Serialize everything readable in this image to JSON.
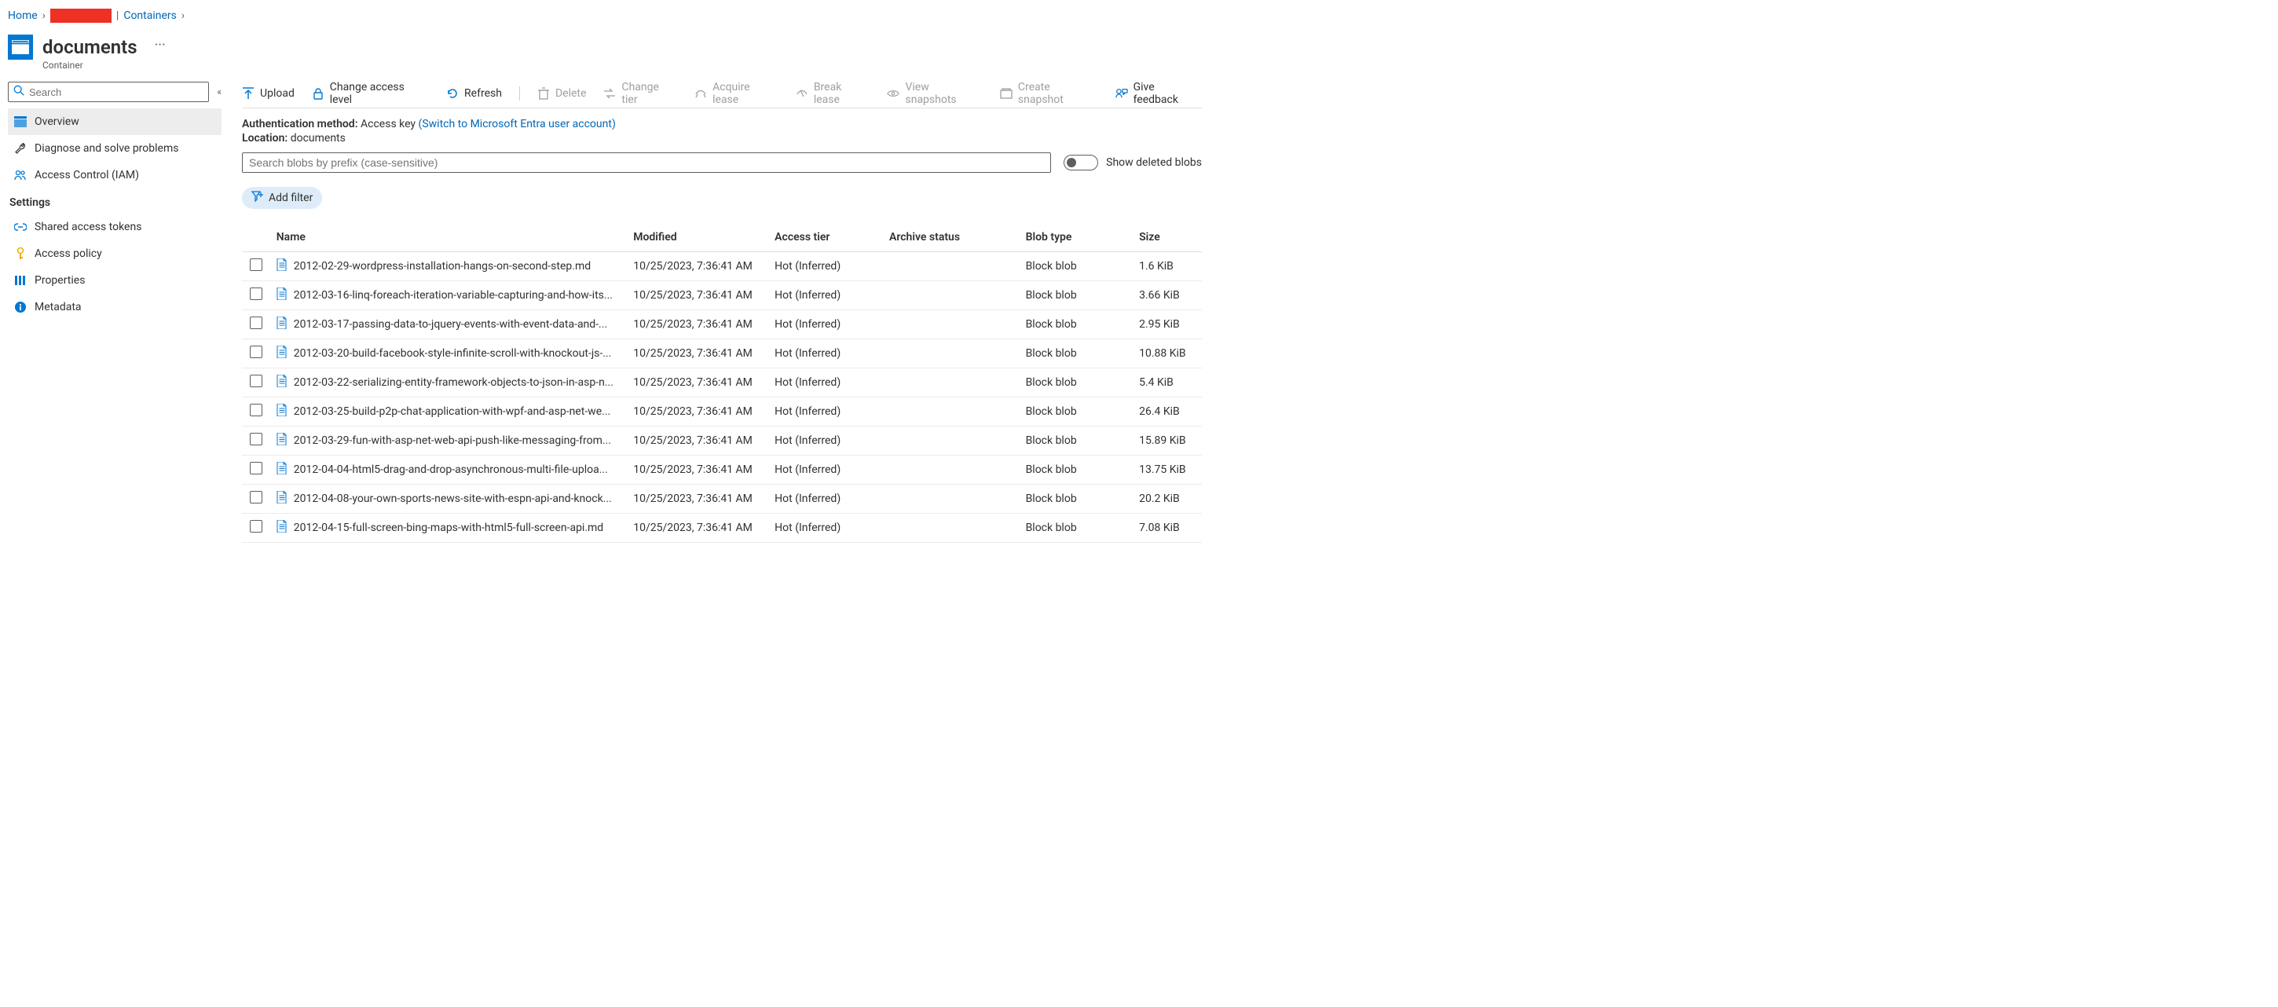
{
  "breadcrumb": {
    "home": "Home",
    "containers": "Containers"
  },
  "title": "documents",
  "subtitle": "Container",
  "sidebar": {
    "search_placeholder": "Search",
    "items": {
      "overview": "Overview",
      "diagnose": "Diagnose and solve problems",
      "iam": "Access Control (IAM)"
    },
    "settings_header": "Settings",
    "settings": {
      "sas": "Shared access tokens",
      "access_policy": "Access policy",
      "properties": "Properties",
      "metadata": "Metadata"
    }
  },
  "toolbar": {
    "upload": "Upload",
    "change_access": "Change access level",
    "refresh": "Refresh",
    "delete": "Delete",
    "change_tier": "Change tier",
    "acquire_lease": "Acquire lease",
    "break_lease": "Break lease",
    "view_snapshots": "View snapshots",
    "create_snapshot": "Create snapshot",
    "feedback": "Give feedback"
  },
  "meta": {
    "auth_label": "Authentication method:",
    "auth_value": "Access key",
    "switch_link": "(Switch to Microsoft Entra user account)",
    "location_label": "Location:",
    "location_value": "documents"
  },
  "search_blobs_placeholder": "Search blobs by prefix (case-sensitive)",
  "show_deleted_label": "Show deleted blobs",
  "add_filter_label": "Add filter",
  "columns": {
    "name": "Name",
    "modified": "Modified",
    "tier": "Access tier",
    "archive": "Archive status",
    "type": "Blob type",
    "size": "Size"
  },
  "rows": [
    {
      "name": "2012-02-29-wordpress-installation-hangs-on-second-step.md",
      "modified": "10/25/2023, 7:36:41 AM",
      "tier": "Hot (Inferred)",
      "archive": "",
      "type": "Block blob",
      "size": "1.6 KiB"
    },
    {
      "name": "2012-03-16-linq-foreach-iteration-variable-capturing-and-how-its...",
      "modified": "10/25/2023, 7:36:41 AM",
      "tier": "Hot (Inferred)",
      "archive": "",
      "type": "Block blob",
      "size": "3.66 KiB"
    },
    {
      "name": "2012-03-17-passing-data-to-jquery-events-with-event-data-and-...",
      "modified": "10/25/2023, 7:36:41 AM",
      "tier": "Hot (Inferred)",
      "archive": "",
      "type": "Block blob",
      "size": "2.95 KiB"
    },
    {
      "name": "2012-03-20-build-facebook-style-infinite-scroll-with-knockout-js-...",
      "modified": "10/25/2023, 7:36:41 AM",
      "tier": "Hot (Inferred)",
      "archive": "",
      "type": "Block blob",
      "size": "10.88 KiB"
    },
    {
      "name": "2012-03-22-serializing-entity-framework-objects-to-json-in-asp-n...",
      "modified": "10/25/2023, 7:36:41 AM",
      "tier": "Hot (Inferred)",
      "archive": "",
      "type": "Block blob",
      "size": "5.4 KiB"
    },
    {
      "name": "2012-03-25-build-p2p-chat-application-with-wpf-and-asp-net-we...",
      "modified": "10/25/2023, 7:36:41 AM",
      "tier": "Hot (Inferred)",
      "archive": "",
      "type": "Block blob",
      "size": "26.4 KiB"
    },
    {
      "name": "2012-03-29-fun-with-asp-net-web-api-push-like-messaging-from...",
      "modified": "10/25/2023, 7:36:41 AM",
      "tier": "Hot (Inferred)",
      "archive": "",
      "type": "Block blob",
      "size": "15.89 KiB"
    },
    {
      "name": "2012-04-04-html5-drag-and-drop-asynchronous-multi-file-uploa...",
      "modified": "10/25/2023, 7:36:41 AM",
      "tier": "Hot (Inferred)",
      "archive": "",
      "type": "Block blob",
      "size": "13.75 KiB"
    },
    {
      "name": "2012-04-08-your-own-sports-news-site-with-espn-api-and-knock...",
      "modified": "10/25/2023, 7:36:41 AM",
      "tier": "Hot (Inferred)",
      "archive": "",
      "type": "Block blob",
      "size": "20.2 KiB"
    },
    {
      "name": "2012-04-15-full-screen-bing-maps-with-html5-full-screen-api.md",
      "modified": "10/25/2023, 7:36:41 AM",
      "tier": "Hot (Inferred)",
      "archive": "",
      "type": "Block blob",
      "size": "7.08 KiB"
    }
  ]
}
